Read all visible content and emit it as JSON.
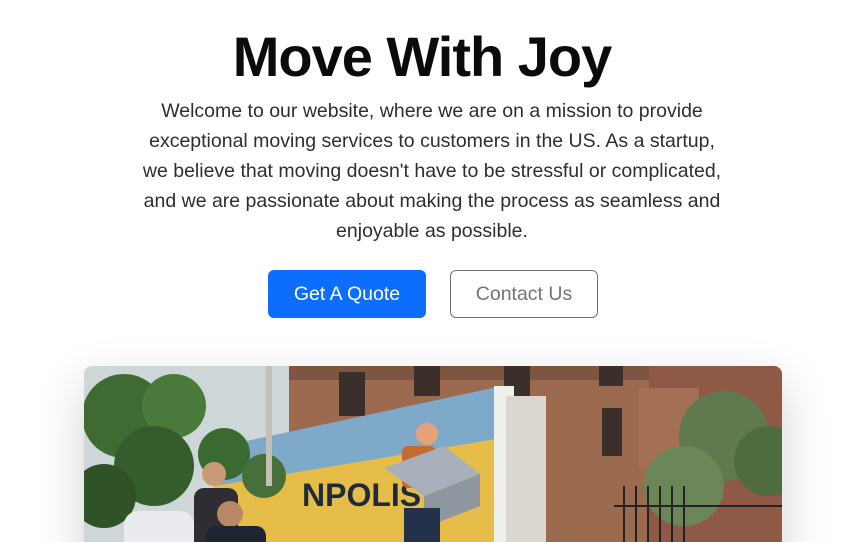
{
  "hero": {
    "title": "Move With Joy",
    "lead": "Welcome to our website, where we are on a mission to provide exceptional moving services to customers in the US. As a startup, we believe that moving doesn't have to be stressful or complicated, and we are passionate about making the process as seamless and enjoyable as possible.",
    "primary_button": "Get A Quote",
    "secondary_button": "Contact Us"
  },
  "photo": {
    "truck_text": "NPOLIS"
  },
  "colors": {
    "primary": "#0d6efd",
    "secondary": "#6c757d"
  }
}
